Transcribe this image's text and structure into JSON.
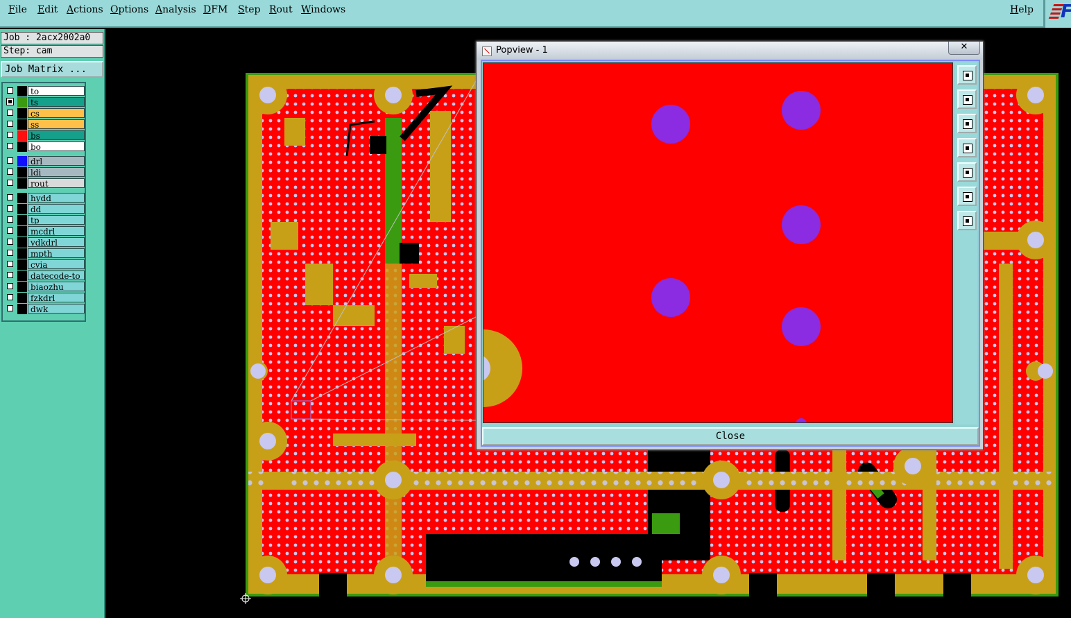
{
  "menubar": {
    "items": [
      "File",
      "Edit",
      "Actions",
      "Options",
      "Analysis",
      "DFM",
      "Step",
      "Rout",
      "Windows"
    ],
    "help": "Help"
  },
  "job": {
    "job_label": "Job : 2acx2002a0",
    "step_label": "Step: cam",
    "matrix_button": "Job Matrix ..."
  },
  "layers": [
    {
      "name": "to",
      "checked": false,
      "swatch": "#000000",
      "bg": "#ffffff"
    },
    {
      "name": "ts",
      "checked": true,
      "swatch": "#3a9a10",
      "bg": "#14a08a"
    },
    {
      "name": "cs",
      "checked": false,
      "swatch": "#000000",
      "bg": "#ffc04a"
    },
    {
      "name": "ss",
      "checked": false,
      "swatch": "#000000",
      "bg": "#ffc04a"
    },
    {
      "name": "bs",
      "checked": false,
      "swatch": "#ff1010",
      "bg": "#14a08a"
    },
    {
      "name": "bo",
      "checked": false,
      "swatch": "#000000",
      "bg": "#ffffff"
    },
    {
      "name": "drl",
      "checked": false,
      "swatch": "#1010ff",
      "bg": "#a7b9c0"
    },
    {
      "name": "ldi",
      "checked": false,
      "swatch": "#000000",
      "bg": "#a7b9c0"
    },
    {
      "name": "rout",
      "checked": false,
      "swatch": "#000000",
      "bg": "#dadada"
    },
    {
      "name": "hydd",
      "checked": false,
      "swatch": "#000000",
      "bg": "#80d6d6"
    },
    {
      "name": "dd",
      "checked": false,
      "swatch": "#000000",
      "bg": "#80d6d6"
    },
    {
      "name": "tp",
      "checked": false,
      "swatch": "#000000",
      "bg": "#80d6d6"
    },
    {
      "name": "mcdrl",
      "checked": false,
      "swatch": "#000000",
      "bg": "#80d6d6"
    },
    {
      "name": "ydkdrl",
      "checked": false,
      "swatch": "#000000",
      "bg": "#80d6d6"
    },
    {
      "name": "mpth",
      "checked": false,
      "swatch": "#000000",
      "bg": "#80d6d6"
    },
    {
      "name": "cvia",
      "checked": false,
      "swatch": "#000000",
      "bg": "#80d6d6"
    },
    {
      "name": "datecode-to",
      "checked": false,
      "swatch": "#000000",
      "bg": "#80d6d6"
    },
    {
      "name": "biaozhu",
      "checked": false,
      "swatch": "#000000",
      "bg": "#80d6d6"
    },
    {
      "name": "fzkdrl",
      "checked": false,
      "swatch": "#000000",
      "bg": "#80d6d6"
    },
    {
      "name": "dwk",
      "checked": false,
      "swatch": "#000000",
      "bg": "#80d6d6"
    }
  ],
  "popview": {
    "title": "Popview - 1",
    "close_x": "✕",
    "close_label": "Close",
    "tools": [
      "zoom-window-icon",
      "pan-up-icon",
      "pan-down-icon",
      "pan-left-icon",
      "pan-right-icon",
      "zoom-fit-icon",
      "zoom-home-icon"
    ]
  },
  "colors": {
    "board_red": "#ff0000",
    "copper_gold": "#c8a018",
    "pad_lavender": "#c8c8f0",
    "solder_green": "#3a9a10",
    "via_purple": "#8b2be2",
    "menubar": "#99d9d9",
    "panel": "#5fcfb2"
  }
}
